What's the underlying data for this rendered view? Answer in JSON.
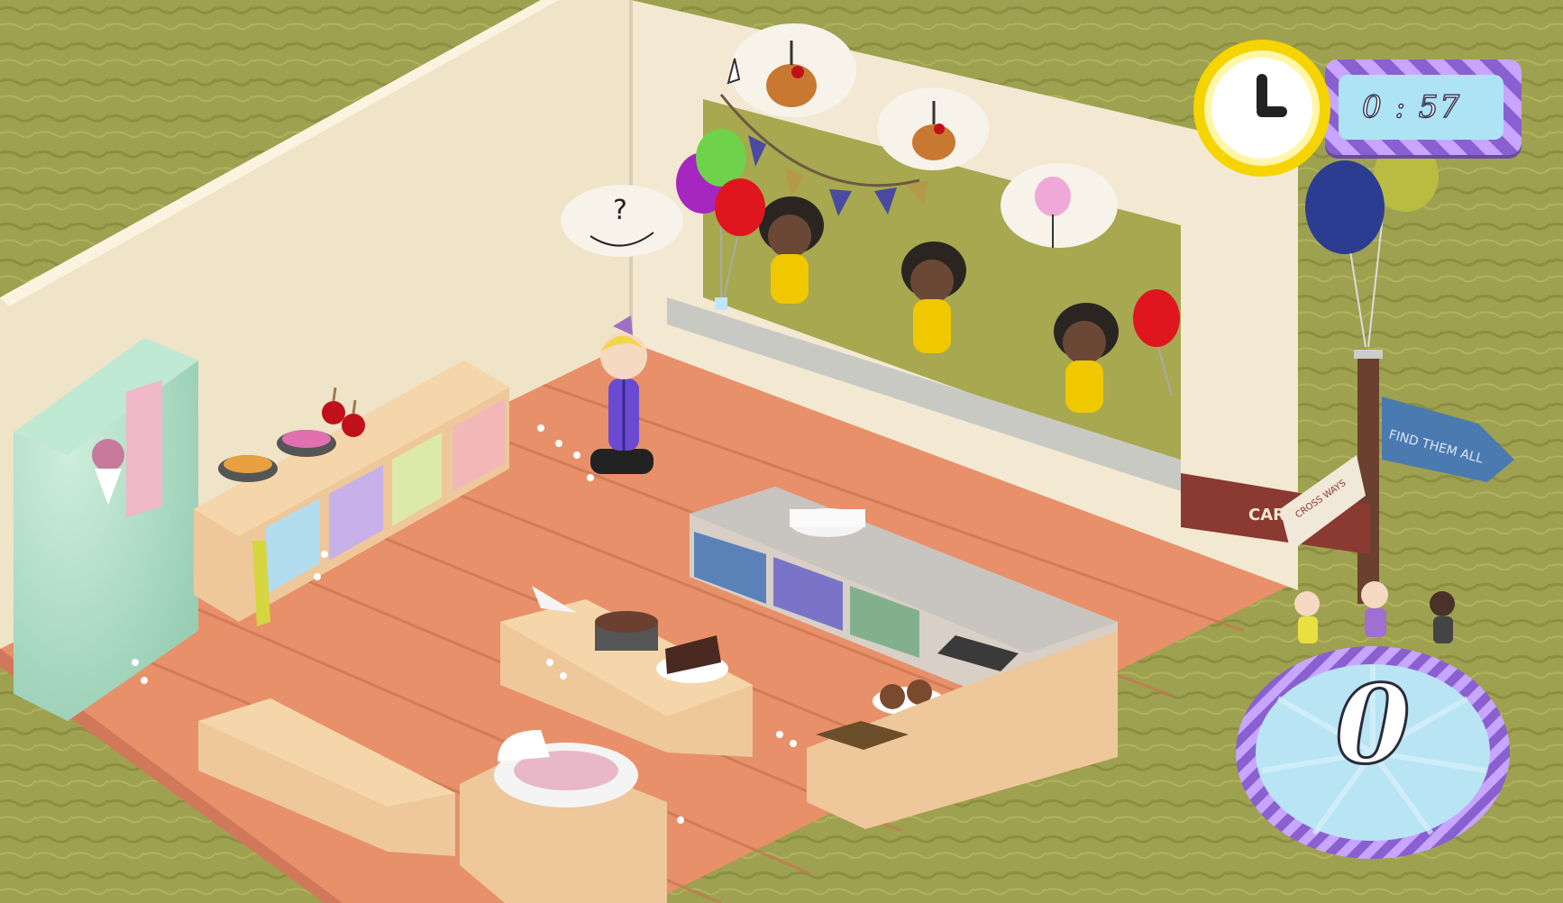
{
  "hud": {
    "timer": {
      "text": "0 : 57",
      "icon": "clock-icon"
    },
    "score": {
      "value": "0"
    }
  },
  "signpost": {
    "sign_right": "FIND THEM ALL",
    "sign_left": "CART",
    "sign_small": "CROSS WAYS"
  },
  "speech_bubbles": [
    {
      "icon": "one-caramel-apple-order-icon"
    },
    {
      "icon": "one-caramel-apple-order-icon"
    },
    {
      "icon": "one-cotton-candy-order-icon"
    },
    {
      "icon": "question-hand-icon"
    }
  ],
  "colors": {
    "grass": "#9a9d4c",
    "floor": "#e8906a",
    "wall": "#efe3c8",
    "timer_frame": "#8a5fd0",
    "clock_yellow": "#f5d400",
    "score_frame": "#8a5fd0"
  }
}
